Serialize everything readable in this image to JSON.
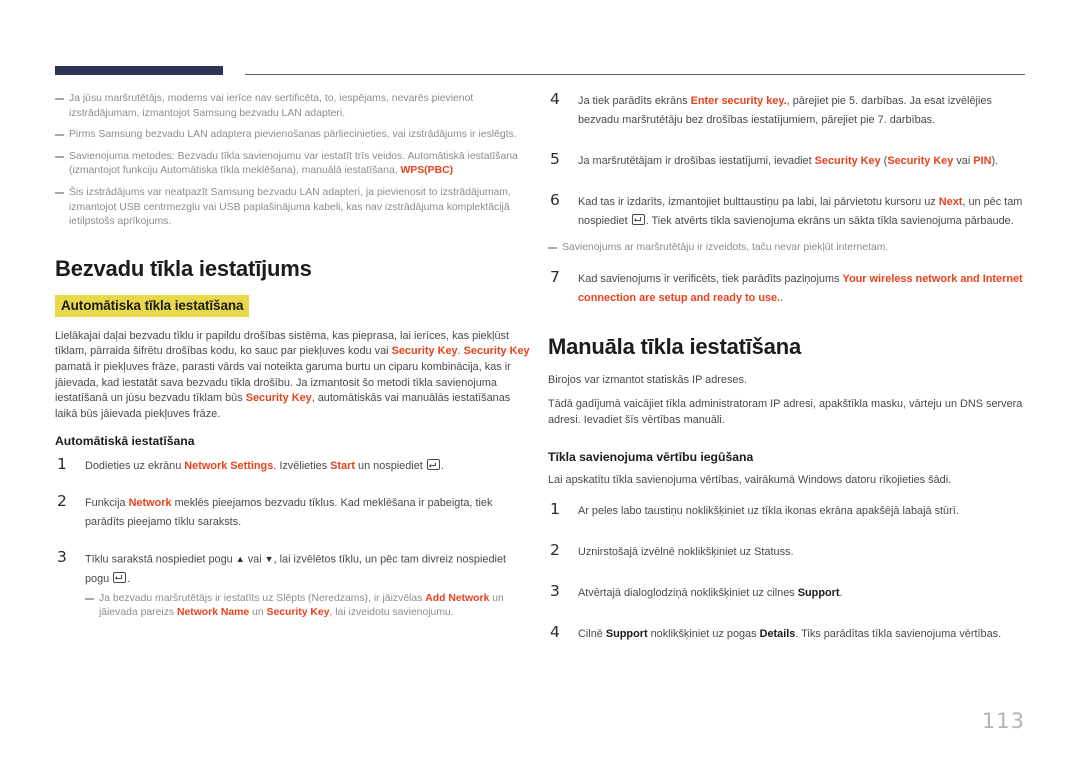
{
  "document": {
    "page_number": "113",
    "accent_color": "#e8421e",
    "highlight_color": "#e9d84c",
    "header_bar_color": "#2c3354"
  },
  "left_column": {
    "notes_top": [
      {
        "lines": [
          "Ja jūsu maršrutētājs, modems vai ierīce nav sertificēta, to, iespējams, nevarēs pievienot izstrādājumam,",
          "izmantojot Samsung bezvadu LAN adapteri."
        ]
      },
      {
        "lines": [
          "Pirms Samsung bezvadu LAN adaptera pievienošanas pārliecinieties, vai izstrādājums ir ieslēgts."
        ]
      },
      {
        "lines": [
          "Savienojuma metodes: Bezvadu tīkla savienojumu var iestatīt trīs veidos.",
          "Automātiskā iestatīšana (izmantojot funkciju Automātiska tīkla meklēšana), manuālā iestatīšana,"
        ],
        "keyword": "WPS(PBC)"
      },
      {
        "lines": [
          "Šis izstrādājums var neatpazīt Samsung bezvadu LAN adapteri, ja pievienosit to izstrādājumam,",
          "izmantojot USB centrmezglu vai USB paplašinājuma kabeli, kas nav izstrādājuma komplektācijā",
          "ietilpstošs aprīkojums."
        ]
      }
    ],
    "section_title": "Bezvadu tīkla iestatījums",
    "highlighted_subheading": "Automātiska tīkla iestatīšana",
    "intro_paragraph": {
      "part1": "Lielākajai daļai bezvadu tīklu ir papildu drošības sistēma, kas pieprasa, lai ierīces, kas piekļūst tīklam, pārraida šifrētu drošības kodu, ko sauc par piekļuves kodu vai ",
      "kw1": "Security Key",
      "part2": ". ",
      "kw2": "Security Key",
      "part3": " pamatā ir piekļuves frāze, parasti vārds vai noteikta garuma burtu un ciparu kombinācija, kas ir jāievada, kad iestatāt sava bezvadu tīkla drošību. Ja izmantosit šo metodi tīkla savienojuma iestatīšanā un jūsu bezvadu tīklam būs ",
      "kw3": "Security Key",
      "part4": ", automātiskās vai manuālās iestatīšanas laikā būs jāievada piekļuves frāze."
    },
    "subheading": "Automātiskā iestatīšana",
    "steps": [
      {
        "num": "1",
        "p1": "Dodieties uz ekrānu ",
        "kw1": "Network Settings",
        "p2": ". Izvēlieties ",
        "kw2": "Start",
        "p3": " un nospiediet ",
        "enter_icon": "enter-key-icon",
        "p4": "."
      },
      {
        "num": "2",
        "p1": "Funkcija ",
        "kw1": "Network",
        "p2": " meklēs pieejamos bezvadu tīklus. Kad meklēšana ir pabeigta, tiek parādīts pieejamo tīklu saraksts."
      },
      {
        "num": "3",
        "p1": "Tīklu sarakstā nospiediet pogu ",
        "up_icon": "▲",
        "p2": " vai ",
        "down_icon": "▼",
        "p3": ", lai izvēlētos tīklu, un pēc tam divreiz nospiediet pogu ",
        "enter_icon": "enter-key-icon",
        "p4": ".",
        "note": {
          "p1": "Ja bezvadu maršrutētājs ir iestatīts uz Slēpts (Neredzams), ir jāizvēlas ",
          "kw1": "Add Network",
          "p2": " un jāievada pareizs ",
          "kw2": "Network Name",
          "p3": " un ",
          "kw3": "Security Key",
          "p4": ", lai izveidotu savienojumu."
        }
      }
    ]
  },
  "right_column": {
    "steps_top": [
      {
        "num": "4",
        "p1": "Ja tiek parādīts ekrāns ",
        "kw1": "Enter security key.",
        "p2": ", pārejiet pie 5. darbības. Ja esat izvēlējies bezvadu maršrutētāju bez drošības iestatījumiem, pārejiet pie 7. darbības."
      },
      {
        "num": "5",
        "p1": "Ja maršrutētājam ir drošības iestatījumi, ievadiet ",
        "kw1": "Security Key",
        "p2": " (",
        "kw2": "Security Key",
        "p3": " vai ",
        "kw3": "PIN",
        "p4": ")."
      },
      {
        "num": "6",
        "p1": "Kad tas ir izdarīts, izmantojiet bulttaustiņu pa labi, lai pārvietotu kursoru uz ",
        "kw1": "Next",
        "p2": ", un pēc tam nospiediet ",
        "enter_icon": "enter-key-icon",
        "p3": ". Tiek atvērts tīkla savienojuma ekrāns un sākta tīkla savienojuma pārbaude."
      }
    ],
    "note_middle": "Savienojums ar maršrutētāju ir izveidots, taču nevar piekļūt internetam.",
    "step_seven": {
      "num": "7",
      "p1": "Kad savienojums ir verificēts, tiek parādīts paziņojums ",
      "kw1": "Your wireless network and Internet connection are setup and ready to use.",
      "p2": "."
    },
    "section_title": "Manuāla tīkla iestatīšana",
    "paragraph1": "Birojos var izmantot statiskās IP adreses.",
    "paragraph2": "Tādā gadījumā vaicājiet tīkla administratoram IP adresi, apakštīkla masku, vārteju un DNS servera adresi. Ievadiet šīs vērtības manuāli.",
    "subheading": "Tīkla savienojuma vērtību iegūšana",
    "paragraph3": "Lai apskatītu tīkla savienojuma vērtības, vairākumā Windows datoru rīkojieties šādi.",
    "steps_bottom": [
      {
        "num": "1",
        "p1": "Ar peles labo taustiņu noklikšķiniet uz tīkla ikonas ekrāna apakšējā labajā stūrī."
      },
      {
        "num": "2",
        "p1": "Uznirstošajā izvēlnē noklikšķiniet uz Statuss."
      },
      {
        "num": "3",
        "p1": "Atvērtajā dialoglodziņā noklikšķiniet uz cilnes ",
        "bk1": "Support",
        "p2": "."
      },
      {
        "num": "4",
        "p1": "Cilnē ",
        "bk1": "Support",
        "p2": " noklikšķiniet uz pogas ",
        "bk2": "Details",
        "p3": ". Tiks parādītas tīkla savienojuma vērtības."
      }
    ]
  }
}
